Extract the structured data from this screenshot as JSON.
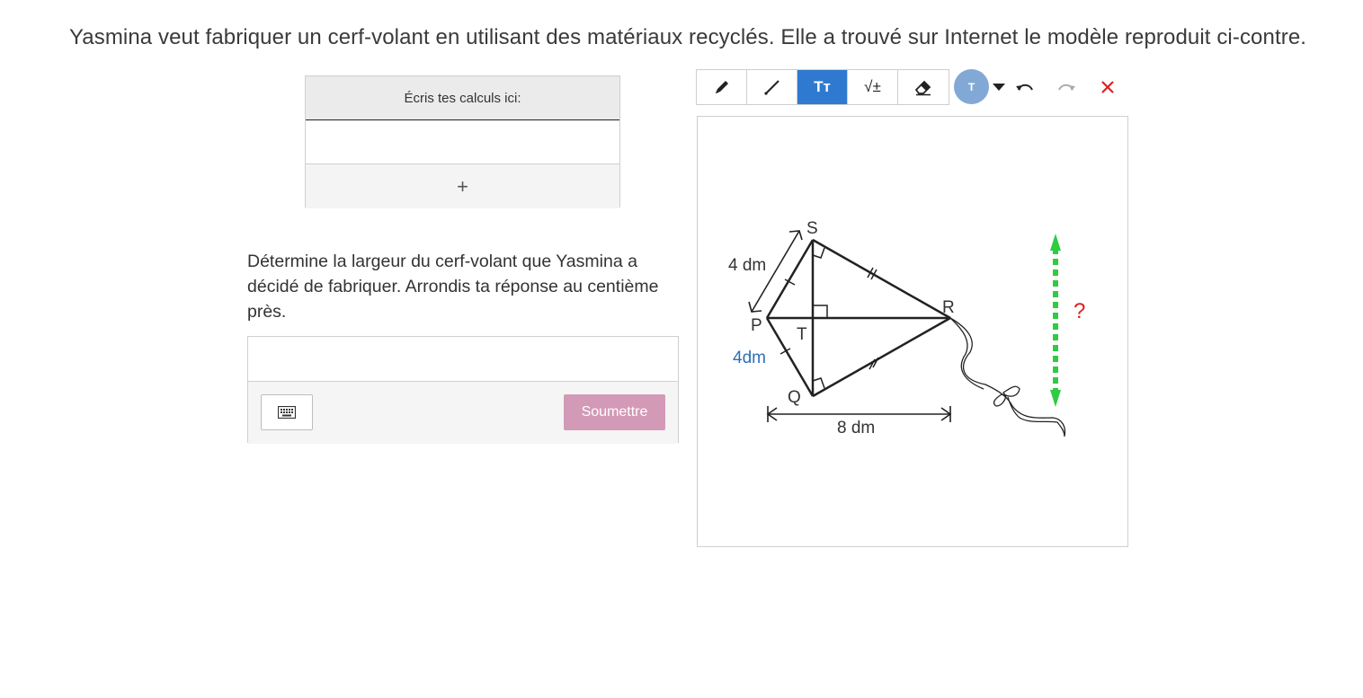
{
  "question": {
    "title": "Yasmina veut fabriquer un cerf-volant en utilisant des matériaux recyclés. Elle a trouvé sur Internet le modèle reproduit ci-contre.",
    "prompt": "Détermine la largeur du cerf-volant que Yasmina a décidé de fabriquer. Arrondis ta réponse au centième près."
  },
  "calc_panel": {
    "header": "Écris tes calculs ici:",
    "add_symbol": "+"
  },
  "answer": {
    "input_value": "",
    "submit_label": "Soumettre"
  },
  "toolbar": {
    "tools": [
      {
        "name": "pencil",
        "icon": "pencil-icon",
        "active": false
      },
      {
        "name": "line",
        "icon": "line-icon",
        "active": false
      },
      {
        "name": "text",
        "icon": "text-icon",
        "label": "Tт",
        "active": true
      },
      {
        "name": "math",
        "icon": "sqrt-icon",
        "label": "√±",
        "active": false
      },
      {
        "name": "eraser",
        "icon": "eraser-icon",
        "active": false
      }
    ],
    "color_label": "T",
    "colors": {
      "active_tool": "#2f7ad0",
      "color_dot": "#82a8d6",
      "close": "#e02020",
      "submit": "#d39ab7"
    }
  },
  "figure": {
    "vertices": {
      "S": "S",
      "R": "R",
      "P": "P",
      "T": "T",
      "Q": "Q"
    },
    "length_ps": "4 dm",
    "length_pq": "4dm",
    "length_pr": "8 dm",
    "unknown": "?",
    "colors": {
      "lines": "#222222",
      "pq_label": "#2e6fb7",
      "arrow": "#2ecc40",
      "question": "#e02020"
    }
  }
}
